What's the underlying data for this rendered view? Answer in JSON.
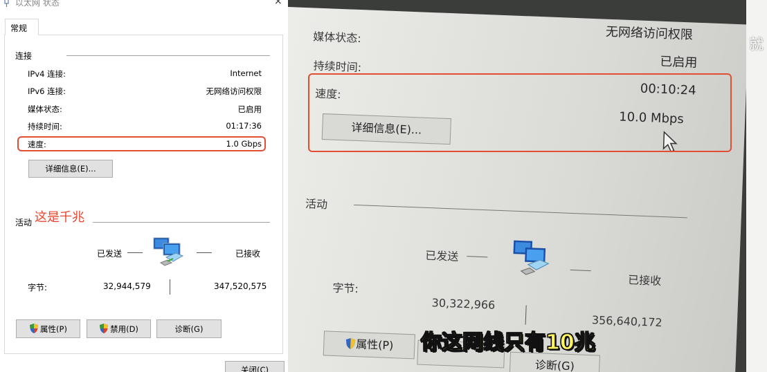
{
  "dialog": {
    "title": "以太网 状态",
    "close_glyph": "×",
    "tab": "常规",
    "connection": {
      "group_label": "连接",
      "rows": [
        {
          "label": "IPv4 连接:",
          "value": "Internet"
        },
        {
          "label": "IPv6 连接:",
          "value": "无网络访问权限"
        },
        {
          "label": "媒体状态:",
          "value": "已启用"
        },
        {
          "label": "持续时间:",
          "value": "01:17:36"
        },
        {
          "label": "速度:",
          "value": "1.0 Gbps"
        }
      ],
      "details_button": "详细信息(E)..."
    },
    "annotation": "这是千兆",
    "activity": {
      "group_label": "活动",
      "sent_label": "已发送",
      "received_label": "已接收",
      "bytes_label": "字节:",
      "bytes_sent": "32,944,579",
      "bytes_received": "347,520,575"
    },
    "buttons": {
      "properties": "属性(P)",
      "disable": "禁用(D)",
      "diagnose": "诊断(G)",
      "close": "关闭(C)"
    }
  },
  "photo": {
    "top_partial": "无网络访问权限",
    "media_label": "媒体状态:",
    "media_value": "已启用",
    "duration_label": "持续时间:",
    "duration_value": "00:10:24",
    "speed_label": "速度:",
    "speed_value": "10.0 Mbps",
    "details_button": "详细信息(E)...",
    "activity_label": "活动",
    "sent_label": "已发送",
    "received_label": "已接收",
    "bytes_label": "字节:",
    "bytes_sent": "30,322,966",
    "bytes_received": "356,640,172",
    "properties_button": "属性(P)",
    "diagnose_button": "诊断(G)",
    "caption": "你这网线只有10兆",
    "edge_text": "就"
  },
  "colors": {
    "highlight": "#e24e32",
    "annotation": "#e8452c",
    "caption": "#fff45c"
  },
  "icons": [
    "network-icon",
    "shield-icon",
    "cursor-icon",
    "close-icon"
  ]
}
